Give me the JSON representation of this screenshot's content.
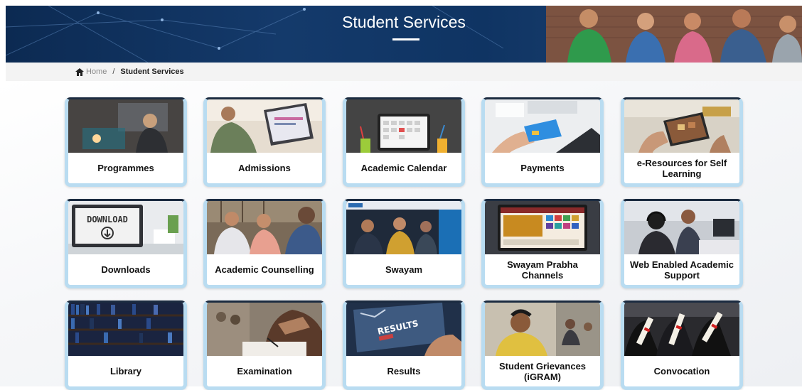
{
  "banner": {
    "title": "Student Services"
  },
  "breadcrumb": {
    "home": "Home",
    "separator": "/",
    "current": "Student Services"
  },
  "colors": {
    "banner_blue": "#0f3463",
    "tile_border": "#b9dcf1",
    "tile_top_border": "#1b2b40"
  },
  "tiles": [
    {
      "label": "Programmes",
      "icon": "programmes-photo"
    },
    {
      "label": "Admissions",
      "icon": "admissions-photo"
    },
    {
      "label": "Academic Calendar",
      "icon": "calendar-photo"
    },
    {
      "label": "Payments",
      "icon": "payments-photo"
    },
    {
      "label": "e-Resources for Self Learning",
      "icon": "tablet-photo"
    },
    {
      "label": "Downloads",
      "icon": "download-photo",
      "image_text": "DOWNLOAD"
    },
    {
      "label": "Academic Counselling",
      "icon": "counselling-photo"
    },
    {
      "label": "Swayam",
      "icon": "swayam-photo"
    },
    {
      "label": "Swayam Prabha Channels",
      "icon": "channels-photo"
    },
    {
      "label": "Web Enabled Academic Support",
      "icon": "headset-photo"
    },
    {
      "label": "Library",
      "icon": "library-photo"
    },
    {
      "label": "Examination",
      "icon": "examination-photo"
    },
    {
      "label": "Results",
      "icon": "results-photo",
      "image_text": "RESULTS"
    },
    {
      "label": "Student Grievances (iGRAM)",
      "icon": "grievance-photo"
    },
    {
      "label": "Convocation",
      "icon": "convocation-photo"
    }
  ]
}
